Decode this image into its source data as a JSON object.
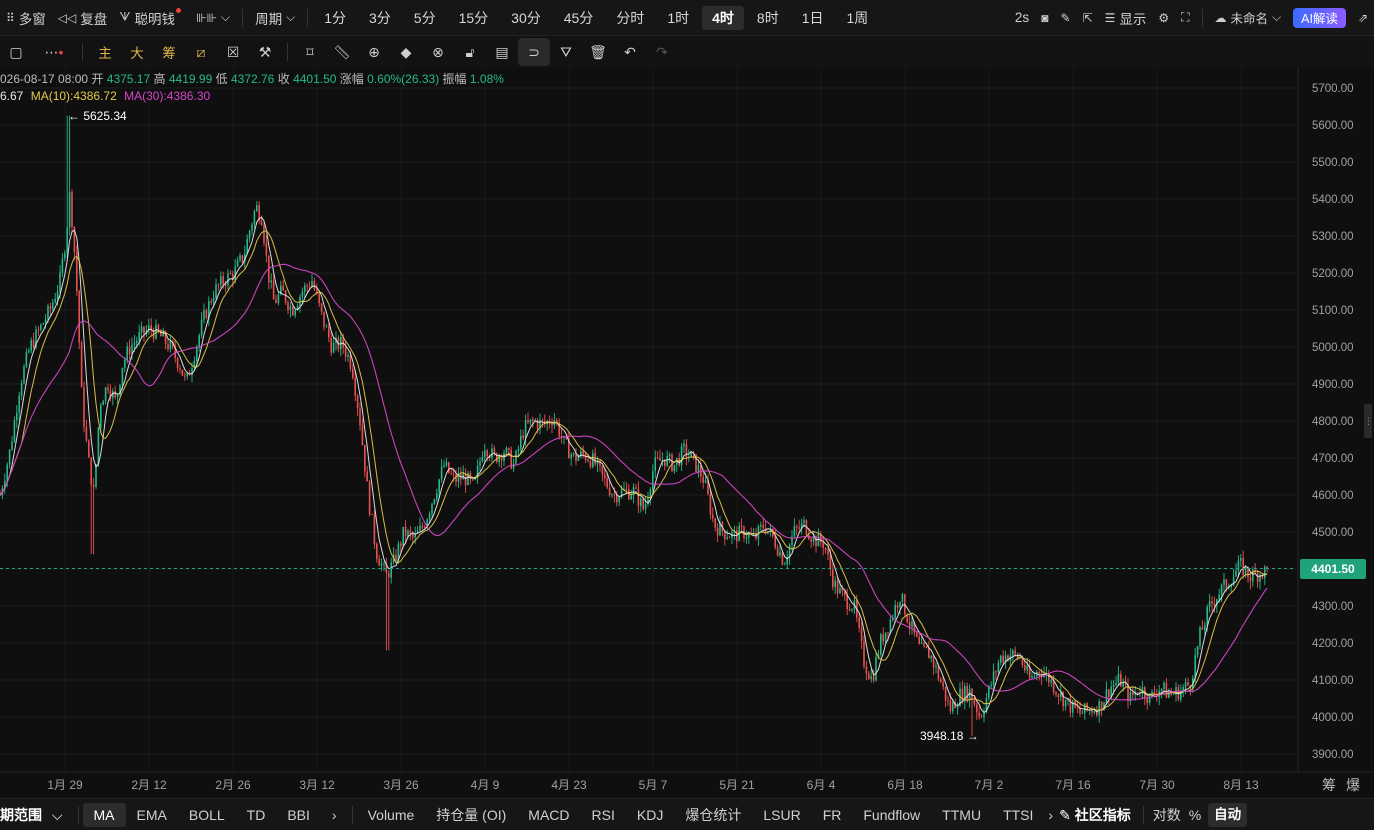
{
  "topbar": {
    "multi_window": "多窗",
    "replay": "复盘",
    "smart_money": "聪明钱",
    "period_label": "周期",
    "periods": [
      "1分",
      "3分",
      "5分",
      "15分",
      "30分",
      "45分",
      "分时",
      "1时",
      "4时",
      "8时",
      "1日",
      "1周"
    ],
    "active_period": "4时",
    "refresh": "2s",
    "display": "显示",
    "layout_name": "未命名",
    "ai_label": "AI解读"
  },
  "drawbar": {
    "main": "主",
    "large": "大",
    "chip": "筹"
  },
  "info": {
    "date": "026-08-17 08:00",
    "open_label": "开",
    "open": "4375.17",
    "high_label": "高",
    "high": "4419.99",
    "low_label": "低",
    "low": "4372.76",
    "close_label": "收",
    "close": "4401.50",
    "change_label": "涨幅",
    "change": "0.60%(26.33)",
    "amp_label": "振幅",
    "amp": "1.08%",
    "ma5_value": "6.67",
    "ma10": "MA(10):4386.72",
    "ma30": "MA(30):4386.30"
  },
  "annotations": {
    "high_mark": "← 5625.34",
    "low_mark": "3948.18 →"
  },
  "current_price": "4401.50",
  "colors": {
    "up": "#26b98a",
    "down": "#e8514f",
    "ma5": "#e8e8e8",
    "ma10": "#e3c84a",
    "ma30": "#d347c8",
    "accent": "#20a27a"
  },
  "corner": {
    "chip": "筹",
    "liq": "爆"
  },
  "bottombar": {
    "range": "期范围",
    "main_indicators": [
      "MA",
      "EMA",
      "BOLL",
      "TD",
      "BBI"
    ],
    "active_main": "MA",
    "sub_indicators": [
      "Volume",
      "持仓量 (OI)",
      "MACD",
      "RSI",
      "KDJ",
      "爆仓统计",
      "LSUR",
      "FR",
      "Fundflow",
      "TTMU",
      "TTSI"
    ],
    "community": "社区指标",
    "log": "对数",
    "percent": "%",
    "auto": "自动"
  },
  "chart_data": {
    "type": "candlestick",
    "y_ticks": [
      "5700.00",
      "5600.00",
      "5500.00",
      "5400.00",
      "5300.00",
      "5200.00",
      "5100.00",
      "5000.00",
      "4900.00",
      "4800.00",
      "4700.00",
      "4600.00",
      "4500.00",
      "4400.00",
      "4300.00",
      "4200.00",
      "4100.00",
      "4000.00",
      "3900.00"
    ],
    "ylim": [
      3880,
      5750
    ],
    "x_ticks": [
      "1月 29",
      "2月 12",
      "2月 26",
      "3月 12",
      "3月 26",
      "4月 9",
      "4月 23",
      "5月 7",
      "5月 21",
      "6月 4",
      "6月 18",
      "7月 2",
      "7月 16",
      "7月 30",
      "8月 13"
    ],
    "price_path": [
      [
        0,
        4600
      ],
      [
        10,
        4720
      ],
      [
        20,
        4900
      ],
      [
        30,
        5000
      ],
      [
        40,
        5050
      ],
      [
        50,
        5100
      ],
      [
        60,
        5180
      ],
      [
        66,
        5300
      ],
      [
        70,
        5420
      ],
      [
        76,
        5200
      ],
      [
        82,
        4850
      ],
      [
        88,
        4700
      ],
      [
        94,
        4600
      ],
      [
        100,
        4850
      ],
      [
        108,
        4900
      ],
      [
        116,
        4850
      ],
      [
        122,
        4950
      ],
      [
        130,
        5000
      ],
      [
        140,
        5030
      ],
      [
        150,
        5050
      ],
      [
        160,
        5030
      ],
      [
        170,
        5000
      ],
      [
        180,
        4950
      ],
      [
        186,
        4900
      ],
      [
        194,
        4980
      ],
      [
        204,
        5080
      ],
      [
        214,
        5150
      ],
      [
        224,
        5180
      ],
      [
        234,
        5200
      ],
      [
        244,
        5250
      ],
      [
        250,
        5320
      ],
      [
        256,
        5380
      ],
      [
        262,
        5350
      ],
      [
        268,
        5200
      ],
      [
        274,
        5120
      ],
      [
        282,
        5150
      ],
      [
        292,
        5100
      ],
      [
        302,
        5150
      ],
      [
        312,
        5180
      ],
      [
        322,
        5080
      ],
      [
        332,
        5000
      ],
      [
        342,
        5010
      ],
      [
        352,
        4950
      ],
      [
        360,
        4800
      ],
      [
        368,
        4600
      ],
      [
        376,
        4450
      ],
      [
        386,
        4380
      ],
      [
        394,
        4420
      ],
      [
        404,
        4500
      ],
      [
        414,
        4480
      ],
      [
        424,
        4520
      ],
      [
        434,
        4600
      ],
      [
        444,
        4680
      ],
      [
        454,
        4640
      ],
      [
        464,
        4650
      ],
      [
        474,
        4620
      ],
      [
        484,
        4740
      ],
      [
        494,
        4700
      ],
      [
        504,
        4720
      ],
      [
        514,
        4680
      ],
      [
        524,
        4780
      ],
      [
        534,
        4800
      ],
      [
        544,
        4790
      ],
      [
        554,
        4810
      ],
      [
        564,
        4740
      ],
      [
        574,
        4700
      ],
      [
        584,
        4710
      ],
      [
        594,
        4690
      ],
      [
        604,
        4640
      ],
      [
        614,
        4600
      ],
      [
        624,
        4610
      ],
      [
        634,
        4610
      ],
      [
        644,
        4560
      ],
      [
        654,
        4680
      ],
      [
        664,
        4700
      ],
      [
        674,
        4680
      ],
      [
        684,
        4720
      ],
      [
        694,
        4690
      ],
      [
        704,
        4640
      ],
      [
        714,
        4520
      ],
      [
        724,
        4500
      ],
      [
        734,
        4490
      ],
      [
        744,
        4500
      ],
      [
        754,
        4480
      ],
      [
        764,
        4520
      ],
      [
        774,
        4480
      ],
      [
        784,
        4420
      ],
      [
        794,
        4500
      ],
      [
        804,
        4520
      ],
      [
        814,
        4480
      ],
      [
        824,
        4470
      ],
      [
        834,
        4360
      ],
      [
        844,
        4320
      ],
      [
        854,
        4300
      ],
      [
        864,
        4150
      ],
      [
        872,
        4100
      ],
      [
        880,
        4200
      ],
      [
        890,
        4260
      ],
      [
        900,
        4330
      ],
      [
        910,
        4250
      ],
      [
        920,
        4180
      ],
      [
        930,
        4170
      ],
      [
        940,
        4100
      ],
      [
        950,
        4020
      ],
      [
        960,
        4060
      ],
      [
        970,
        4070
      ],
      [
        980,
        4000
      ],
      [
        990,
        4080
      ],
      [
        1000,
        4160
      ],
      [
        1010,
        4170
      ],
      [
        1020,
        4160
      ],
      [
        1030,
        4100
      ],
      [
        1040,
        4130
      ],
      [
        1050,
        4100
      ],
      [
        1060,
        4060
      ],
      [
        1070,
        4030
      ],
      [
        1080,
        4010
      ],
      [
        1090,
        4020
      ],
      [
        1100,
        4030
      ],
      [
        1110,
        4080
      ],
      [
        1120,
        4100
      ],
      [
        1130,
        4050
      ],
      [
        1140,
        4080
      ],
      [
        1150,
        4050
      ],
      [
        1160,
        4080
      ],
      [
        1170,
        4060
      ],
      [
        1180,
        4070
      ],
      [
        1190,
        4090
      ],
      [
        1200,
        4220
      ],
      [
        1210,
        4300
      ],
      [
        1220,
        4340
      ],
      [
        1230,
        4370
      ],
      [
        1240,
        4410
      ],
      [
        1250,
        4380
      ],
      [
        1260,
        4390
      ],
      [
        1268,
        4395
      ]
    ],
    "last_price": 4401.5,
    "high_marker": 5625.34,
    "low_marker": 3948.18,
    "series": [
      {
        "name": "MA(10)",
        "value": 4386.72
      },
      {
        "name": "MA(30)",
        "value": 4386.3
      }
    ],
    "grid": true
  }
}
